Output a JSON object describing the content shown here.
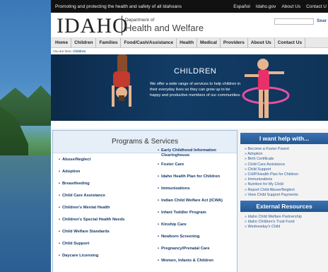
{
  "topbar": {
    "tagline": "Promoting and protecting the health and safety of all Idahoans",
    "links": [
      "Español",
      "Idaho.gov",
      "About Us",
      "Contact U"
    ]
  },
  "header": {
    "logo_text": "IDAHO",
    "dept_line1": "Department of",
    "dept_line2": "Health and Welfare",
    "search_label": "Sear"
  },
  "nav": [
    "Home",
    "Children",
    "Families",
    "Food/Cash/Assistance",
    "Health",
    "Medical",
    "Providers",
    "About Us",
    "Contact Us"
  ],
  "breadcrumb": {
    "prefix": "You are here:",
    "current": "Children"
  },
  "banner": {
    "title": "CHILDREN",
    "text": "We  offer a wide range of services to help children in their everyday lives so they can grow up to be happy and productive members of our communities."
  },
  "programs": {
    "title": "Programs & Services",
    "col_a": [
      "Abuse/Neglect",
      "Adoption",
      "Breastfeeding",
      "Child Care Assistance",
      "Children's Mental Health",
      "Children's Special Health Needs",
      "Child Welfare Standards",
      "Child Support",
      "Daycare Licensing"
    ],
    "col_b": [
      "Early Childhood Information Clearinghouse",
      "Foster Care",
      "Idaho Health Plan for Children",
      "Immunizations",
      "Indian Child Welfare Act (ICWA)",
      "Infant Toddler Program",
      "Kinship Care",
      "Newborn Screening",
      "Pregnancy/Prenatal Care",
      "Women, Infants & Children"
    ]
  },
  "sidebar": {
    "help_title": "I want help with...",
    "help_links": [
      "Become a Foster Parent",
      "Adoption",
      "Birth Certificate",
      "Child Care Assistance",
      "Child Support",
      "CHIP/Health Plan for Children",
      "Immunizations",
      "Nutrition for My Child",
      "Report Child Abuse/Neglect",
      "View Child Support Payments"
    ],
    "external_title": "External Resources",
    "external_links": [
      "Idaho Child Welfare Partnership",
      "Idaho Children's Trust Fund",
      "Wednesday's Child"
    ]
  }
}
